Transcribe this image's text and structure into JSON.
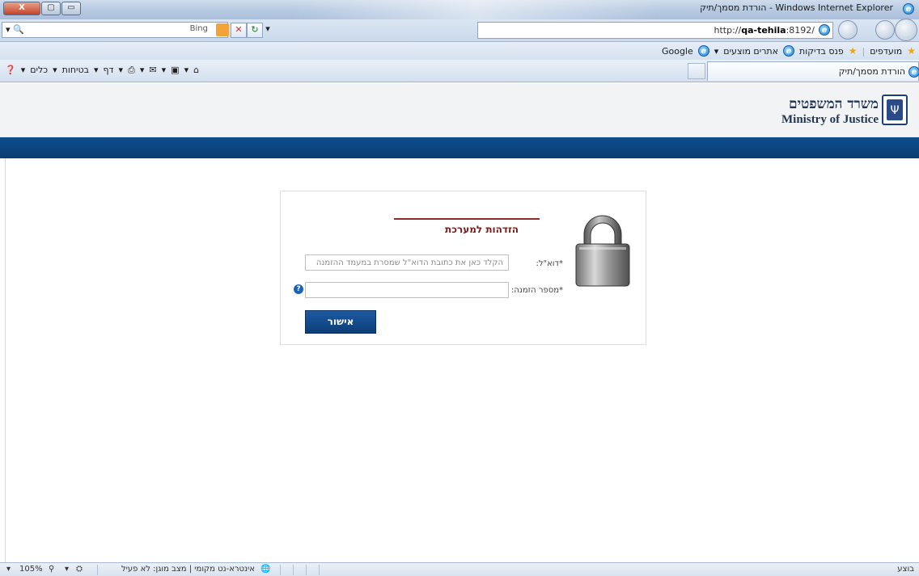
{
  "window": {
    "title": "הורדת מסמך/תיק - Windows Internet Explorer",
    "close_glyph": "X",
    "min_glyph": "▭",
    "restore_glyph": "▢"
  },
  "addressbar": {
    "url_prefix": "http://",
    "url_host": "qa-tehila",
    "url_rest": ":8192/",
    "search_engine": "Bing",
    "search_icon": "search-icon"
  },
  "favorites": {
    "label": "מועדפים",
    "items": [
      "פנס בדיקות",
      "אתרים מוצעים",
      "Google"
    ]
  },
  "tab": {
    "label": "הורדת מסמך/תיק"
  },
  "commands": [
    "דף",
    "בטיחות",
    "כלים"
  ],
  "header": {
    "title_he": "משרד המשפטים",
    "title_en": "Ministry of Justice"
  },
  "login": {
    "title": "הזדהות למערכת",
    "email_label": "*דוא\"ל:",
    "email_placeholder": "הקלד כאן את כתובת הדוא\"ל שמסרת במעמד ההזמנה",
    "order_label": "*מספר הזמנה:",
    "submit_label": "אישור",
    "help_glyph": "?"
  },
  "statusbar": {
    "done_text": "בוצע",
    "zone_text": "אינטרא-נט מקומי | מצב מוגן: לא פעיל",
    "zoom": "105%"
  },
  "colors": {
    "accent_blue": "#0d4c8c",
    "title_red": "#7a1a1a",
    "button_blue": "#1c5aa0"
  }
}
